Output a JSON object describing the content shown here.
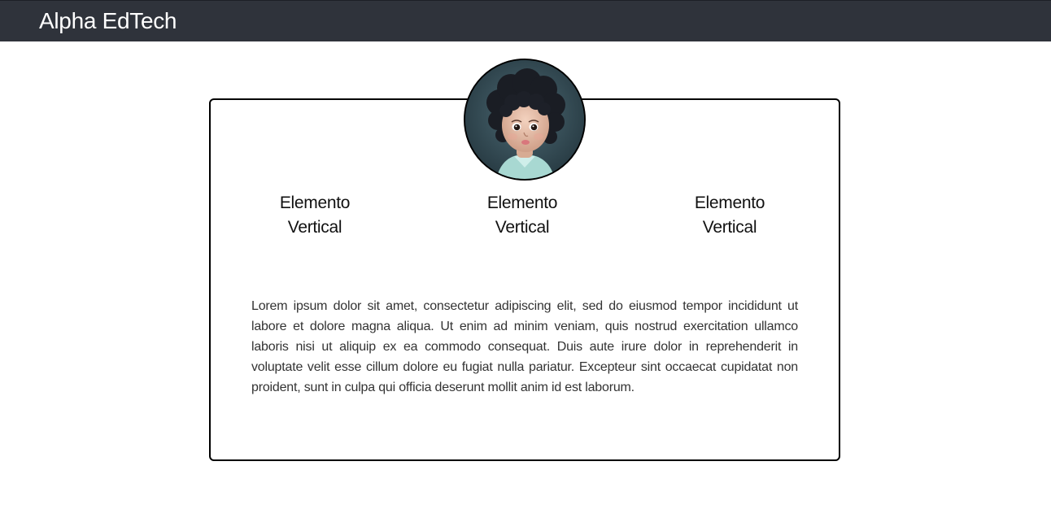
{
  "navbar": {
    "brand": "Alpha EdTech",
    "background": "#2f333b"
  },
  "card": {
    "avatar": {
      "alt": "child portrait",
      "icon": "avatar-photo"
    },
    "columns": [
      {
        "line1": "Elemento",
        "line2": "Vertical"
      },
      {
        "line1": "Elemento",
        "line2": "Vertical"
      },
      {
        "line1": "Elemento",
        "line2": "Vertical"
      }
    ],
    "paragraph": "Lorem ipsum dolor sit amet, consectetur adipiscing elit, sed do eiusmod tempor incididunt ut labore et dolore magna aliqua. Ut enim ad minim veniam, quis nostrud exercitation ullamco laboris nisi ut aliquip ex ea commodo consequat. Duis aute irure dolor in reprehenderit in voluptate velit esse cillum dolore eu fugiat nulla pariatur. Excepteur sint occaecat cupidatat non proident, sunt in culpa qui officia deserunt mollit anim id est laborum."
  }
}
